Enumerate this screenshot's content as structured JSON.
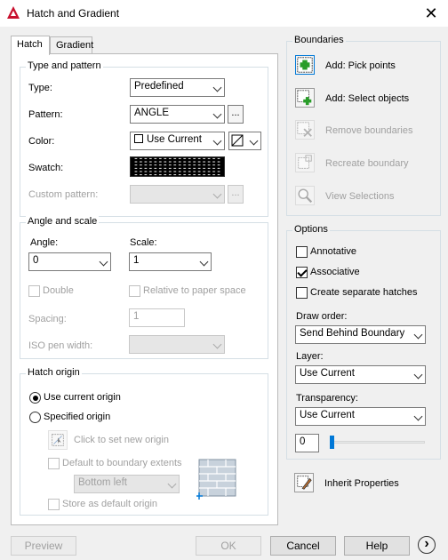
{
  "window": {
    "title": "Hatch and Gradient",
    "close": "✕"
  },
  "tabs": [
    {
      "label": "Hatch"
    },
    {
      "label": "Gradient"
    }
  ],
  "type_pattern": {
    "title": "Type and pattern",
    "type_label": "Type:",
    "type_value": "Predefined",
    "pattern_label": "Pattern:",
    "pattern_value": "ANGLE",
    "color_label": "Color:",
    "color_value": "Use Current",
    "swatch_label": "Swatch:",
    "custom_label": "Custom pattern:",
    "ellipsis": "..."
  },
  "angle_scale": {
    "title": "Angle and scale",
    "angle_label": "Angle:",
    "angle_value": "0",
    "scale_label": "Scale:",
    "scale_value": "1",
    "double_label": "Double",
    "relative_label": "Relative to paper space",
    "spacing_label": "Spacing:",
    "spacing_value": "1",
    "iso_label": "ISO pen width:"
  },
  "hatch_origin": {
    "title": "Hatch origin",
    "use_current": "Use current origin",
    "specified": "Specified origin",
    "click_set": "Click to set new origin",
    "default_ext": "Default to boundary extents",
    "position_value": "Bottom left",
    "store_default": "Store as default origin"
  },
  "boundaries": {
    "title": "Boundaries",
    "pick_points": "Add: Pick points",
    "select_objects": "Add: Select objects",
    "remove": "Remove boundaries",
    "recreate": "Recreate boundary",
    "view": "View Selections"
  },
  "options": {
    "title": "Options",
    "annotative": "Annotative",
    "associative": "Associative",
    "separate": "Create separate hatches",
    "draw_order_label": "Draw order:",
    "draw_order_value": "Send Behind Boundary",
    "layer_label": "Layer:",
    "layer_value": "Use Current",
    "transparency_label": "Transparency:",
    "transparency_value": "Use Current",
    "transparency_number": "0"
  },
  "inherit": "Inherit Properties",
  "footer": {
    "preview": "Preview",
    "ok": "OK",
    "cancel": "Cancel",
    "help": "Help",
    "more": "›"
  },
  "colors": {
    "accent": "#0078d7",
    "autocad_red": "#c8102e"
  }
}
